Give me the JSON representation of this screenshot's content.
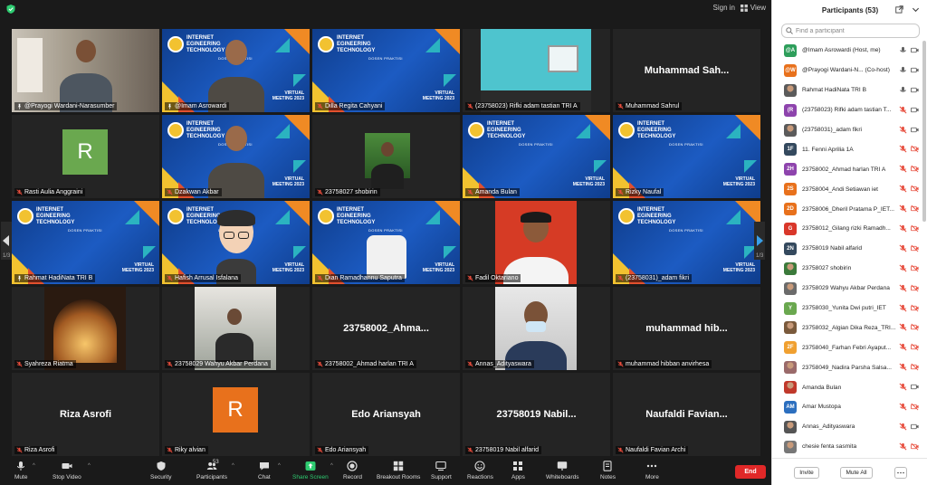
{
  "topbar": {
    "sign_in": "Sign in",
    "view": "View"
  },
  "tiles": [
    {
      "name": "@Prayogi Wardani-Narasumber",
      "kind": "video",
      "active": true,
      "muted": false
    },
    {
      "name": "@Imam Asrowardi",
      "kind": "brand-person",
      "muted": false
    },
    {
      "name": "Dilla Regita Cahyani",
      "kind": "brand",
      "muted": true
    },
    {
      "name": "(23758023) Rifki adam tastian TRI A",
      "kind": "video-wall",
      "muted": true
    },
    {
      "name": "Muhammad Sahrul",
      "kind": "name",
      "big": "Muhammad  Sah...",
      "muted": true
    },
    {
      "name": "Rasti Aulia Anggraini",
      "kind": "avatar",
      "letter": "R",
      "color": "#6aa84f",
      "muted": true
    },
    {
      "name": "Dzakwan Akbar",
      "kind": "brand-person",
      "muted": true
    },
    {
      "name": "23758027 shobirin",
      "kind": "small-video",
      "muted": true
    },
    {
      "name": "Amanda Bulan",
      "kind": "brand",
      "muted": true
    },
    {
      "name": "Rizky Naufal",
      "kind": "brand",
      "muted": true
    },
    {
      "name": "Rahmat HadiNata TRI B",
      "kind": "brand",
      "muted": false
    },
    {
      "name": "Hafish Arrusal Isfalana",
      "kind": "brand-avatar",
      "muted": true
    },
    {
      "name": "Dian Ramadhannu Saputra",
      "kind": "brand-shirt",
      "muted": true
    },
    {
      "name": "Fadil Oktariano",
      "kind": "portrait-red",
      "muted": true
    },
    {
      "name": "(23758031)_adam fikri",
      "kind": "brand",
      "muted": true
    },
    {
      "name": "Syahreza Riatma",
      "kind": "tunnel",
      "muted": true
    },
    {
      "name": "23758029 Wahyu Akbar Perdana",
      "kind": "group",
      "muted": true
    },
    {
      "name": "23758002_Ahmad harlan TRI A",
      "kind": "name",
      "big": "23758002_Ahma...",
      "muted": true
    },
    {
      "name": "Annas_Adityaswara",
      "kind": "mask",
      "muted": true
    },
    {
      "name": "muhammad hibban anvirhesa",
      "kind": "name",
      "big": "muhammad  hib...",
      "muted": true
    },
    {
      "name": "Riza Asrofi",
      "kind": "name",
      "big": "Riza Asrofi",
      "muted": true
    },
    {
      "name": "Riky alvian",
      "kind": "avatar",
      "letter": "R",
      "color": "#e8711c",
      "muted": true
    },
    {
      "name": "Edo Ariansyah",
      "kind": "name",
      "big": "Edo Ariansyah",
      "muted": true
    },
    {
      "name": "23758019 Nabil alfarid",
      "kind": "name",
      "big": "23758019  Nabil...",
      "muted": true
    },
    {
      "name": "Naufaldi Favian Archi",
      "kind": "name",
      "big": "Naufaldi  Favian...",
      "muted": true
    }
  ],
  "brand": {
    "line1": "INTERNET",
    "line2": "EGINEERING",
    "line3": "TECHNOLOGY",
    "sub": "DOSEN PRAKTISI",
    "event1": "VIRTUAL",
    "event2": "MEETING 2023"
  },
  "page_indicator": "1/3",
  "toolbar": {
    "mute": "Mute",
    "stop_video": "Stop Video",
    "security": "Security",
    "participants": "Participants",
    "participants_count": "53",
    "chat": "Chat",
    "share_screen": "Share Screen",
    "record": "Record",
    "breakout": "Breakout Rooms",
    "support": "Support",
    "reactions": "Reactions",
    "apps": "Apps",
    "whiteboards": "Whiteboards",
    "notes": "Notes",
    "more": "More",
    "end": "End"
  },
  "panel": {
    "title": "Participants (53)",
    "search_placeholder": "Find a participant",
    "invite": "Invite",
    "mute_all": "Mute All",
    "participants": [
      {
        "initials": "@A",
        "color": "#2e9e5b",
        "name": "@Imam Asrowardi (Host, me)",
        "mic": "on",
        "cam": "on"
      },
      {
        "initials": "@W",
        "color": "#e8711c",
        "name": "@Prayogi Wardani-N... (Co-host)",
        "mic": "on",
        "cam": "on"
      },
      {
        "initials": "",
        "color": "#5b5b5b",
        "name": "Rahmat HadiNata TRI B",
        "mic": "on",
        "cam": "on",
        "photo": true
      },
      {
        "initials": "(R",
        "color": "#8e44ad",
        "name": "(23758023) Rifki adam tastian T...",
        "mic": "off",
        "cam": "on"
      },
      {
        "initials": "",
        "color": "#5b5b5b",
        "name": "(23758031)_adam fikri",
        "mic": "off",
        "cam": "on",
        "photo": true
      },
      {
        "initials": "1F",
        "color": "#34495e",
        "name": "11. Fenni Aprilia 1A",
        "mic": "off",
        "cam": "off"
      },
      {
        "initials": "2H",
        "color": "#8e44ad",
        "name": "23758002_Ahmad harlan TRI A",
        "mic": "off",
        "cam": "off"
      },
      {
        "initials": "2S",
        "color": "#e8711c",
        "name": "23758004_Andi Setiawan iet",
        "mic": "off",
        "cam": "off"
      },
      {
        "initials": "2D",
        "color": "#e8711c",
        "name": "23758006_Dheril Pratama P_IET...",
        "mic": "off",
        "cam": "off"
      },
      {
        "initials": "G",
        "color": "#d9372a",
        "name": "23758012_Gilang rizki Ramadh...",
        "mic": "off",
        "cam": "off"
      },
      {
        "initials": "2N",
        "color": "#34495e",
        "name": "23758019 Nabil alfarid",
        "mic": "off",
        "cam": "off"
      },
      {
        "initials": "",
        "color": "#3b7a3b",
        "name": "23758027 shobirin",
        "mic": "off",
        "cam": "off",
        "photo": true
      },
      {
        "initials": "",
        "color": "#6b6b6b",
        "name": "23758029 Wahyu Akbar Perdana",
        "mic": "off",
        "cam": "off",
        "photo": true
      },
      {
        "initials": "Y",
        "color": "#6aa84f",
        "name": "23758030_Yunita Dwi putri_IET",
        "mic": "off",
        "cam": "off"
      },
      {
        "initials": "",
        "color": "#7a5a3c",
        "name": "23758032_Algian Dika Reza_TRI...",
        "mic": "off",
        "cam": "off",
        "photo": true
      },
      {
        "initials": "2F",
        "color": "#f0a030",
        "name": "23758040_Farhan Febri Ayaput...",
        "mic": "off",
        "cam": "off"
      },
      {
        "initials": "",
        "color": "#9a6a6a",
        "name": "23758049_Nadira Parsha Salsa...",
        "mic": "off",
        "cam": "off",
        "photo": true
      },
      {
        "initials": "",
        "color": "#c0392b",
        "name": "Amanda Bulan",
        "mic": "off",
        "cam": "on",
        "photo": true
      },
      {
        "initials": "AM",
        "color": "#2c6fbf",
        "name": "Amar Mustopa",
        "mic": "off",
        "cam": "off"
      },
      {
        "initials": "",
        "color": "#555",
        "name": "Annas_Adityaswara",
        "mic": "off",
        "cam": "on",
        "photo": true
      },
      {
        "initials": "",
        "color": "#777",
        "name": "chesie fenta sasmita",
        "mic": "off",
        "cam": "off",
        "photo": true
      }
    ]
  }
}
